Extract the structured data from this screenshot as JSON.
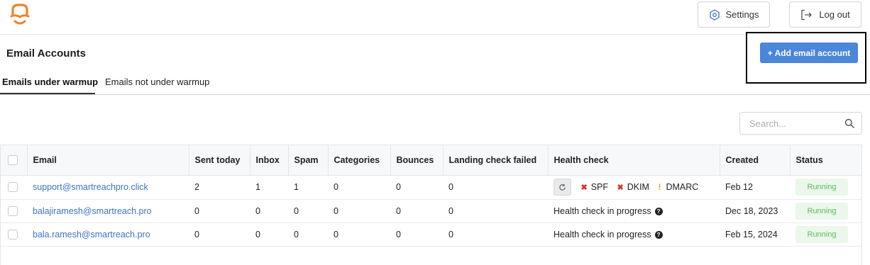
{
  "header": {
    "settings_label": "Settings",
    "logout_label": "Log out",
    "settings_icon": "gear-icon",
    "logout_icon": "logout-icon",
    "brand_color": "#e8862c"
  },
  "page": {
    "title": "Email Accounts",
    "add_button_label": "+ Add email account",
    "accent_color": "#4a86d9"
  },
  "tabs": [
    {
      "label": "Emails under warmup",
      "active": true
    },
    {
      "label": "Emails not under warmup",
      "active": false
    }
  ],
  "search": {
    "placeholder": "Search...",
    "icon": "search-icon"
  },
  "table": {
    "columns": [
      "",
      "Email",
      "Sent today",
      "Inbox",
      "Spam",
      "Categories",
      "Bounces",
      "Landing check failed",
      "Health check",
      "Created",
      "Status"
    ],
    "rows": [
      {
        "email": "support@smartreachpro.click",
        "sent_today": "2",
        "inbox": "1",
        "spam": "1",
        "categories": "0",
        "bounces": "0",
        "landing_failed": "0",
        "health": {
          "type": "checks",
          "items": [
            {
              "label": "SPF",
              "state": "fail",
              "mark": "✖"
            },
            {
              "label": "DKIM",
              "state": "fail",
              "mark": "✖"
            },
            {
              "label": "DMARC",
              "state": "warn",
              "mark": "!"
            }
          ]
        },
        "created": "Feb 12",
        "status": "Running"
      },
      {
        "email": "balajiramesh@smartreach.pro",
        "sent_today": "0",
        "inbox": "0",
        "spam": "0",
        "categories": "0",
        "bounces": "0",
        "landing_failed": "0",
        "health": {
          "type": "progress",
          "text": "Health check in progress"
        },
        "created": "Dec 18, 2023",
        "status": "Running"
      },
      {
        "email": "bala.ramesh@smartreach.pro",
        "sent_today": "0",
        "inbox": "0",
        "spam": "0",
        "categories": "0",
        "bounces": "0",
        "landing_failed": "0",
        "health": {
          "type": "progress",
          "text": "Health check in progress"
        },
        "created": "Feb 15, 2024",
        "status": "Running"
      }
    ],
    "status_color": "#5dbb5d"
  }
}
